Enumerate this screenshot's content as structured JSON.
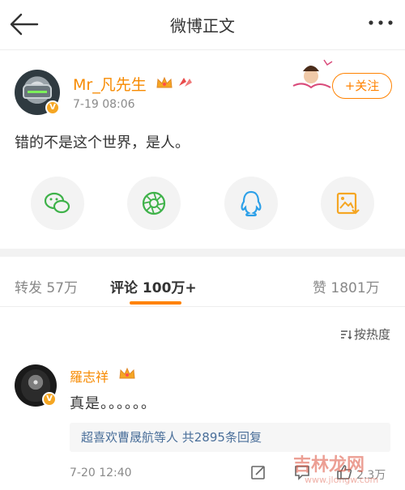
{
  "topbar": {
    "title": "微博正文"
  },
  "post": {
    "username": "Mr_凡先生",
    "date": "7-19 08:06",
    "follow_label": "+关注",
    "text": "错的不是这个世界，是人。",
    "verified_mark": "V",
    "share_icons": [
      "wechat-icon",
      "moments-icon",
      "qq-icon",
      "save-image-icon"
    ]
  },
  "tabs": {
    "repost_label": "转发",
    "repost_count": "57万",
    "comment_label": "评论",
    "comment_count": "100万+",
    "like_label": "赞",
    "like_count": "1801万"
  },
  "comments": {
    "sort_label": "按热度",
    "items": [
      {
        "name": "羅志祥",
        "text": "真是。。。。。。",
        "replies_text": "超喜欢曹晟航等人 共2895条回复",
        "date": "7-20 12:40",
        "like_count": "2.3万"
      }
    ]
  },
  "watermark": {
    "text": "吉林龙网",
    "url": "www.jlongw.com"
  },
  "colors": {
    "accent": "#ff8200",
    "username": "#f78a00",
    "link": "#4a6f9a"
  }
}
